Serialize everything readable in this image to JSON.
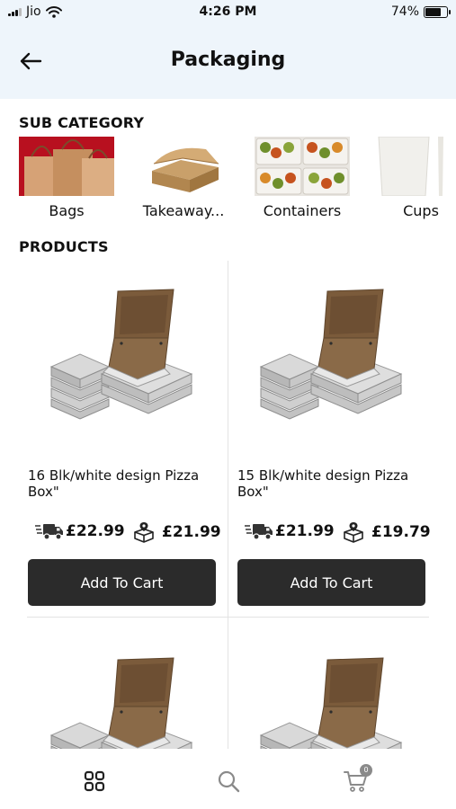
{
  "status_bar": {
    "carrier": "Jio",
    "time": "4:26 PM",
    "battery": "74%",
    "battery_level": 0.74
  },
  "header": {
    "title": "Packaging",
    "back_icon": "arrow-left-icon"
  },
  "sub_category": {
    "heading": "SUB CATEGORY",
    "items": [
      {
        "label": "Bags"
      },
      {
        "label": "Takeaway..."
      },
      {
        "label": "Containers"
      },
      {
        "label": "Cups"
      }
    ]
  },
  "products": {
    "heading": "PRODUCTS",
    "items": [
      {
        "name": "16 Blk/white design Pizza Box\"",
        "delivery_price": "£22.99",
        "collection_price": "£21.99",
        "button": "Add To Cart"
      },
      {
        "name": "15 Blk/white  design Pizza Box\"",
        "delivery_price": "£21.99",
        "collection_price": "£19.79",
        "button": "Add To Cart"
      }
    ]
  },
  "bottom_nav": {
    "items": [
      {
        "icon": "grid-icon"
      },
      {
        "icon": "search-icon"
      },
      {
        "icon": "cart-icon",
        "badge": "0"
      }
    ]
  },
  "colors": {
    "header_bg": "#eef5fb",
    "button_bg": "#2b2b2b",
    "divider": "#e3e3e3"
  }
}
